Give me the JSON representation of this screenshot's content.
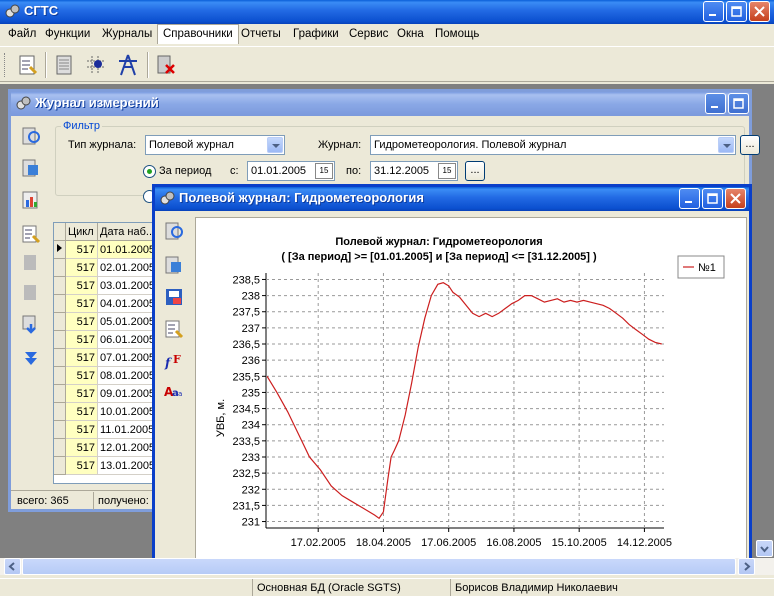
{
  "app": {
    "title": "СГТС"
  },
  "menu": {
    "items": [
      "Файл",
      "Функции",
      "Журналы",
      "Справочники",
      "Отчеты",
      "Графики",
      "Сервис",
      "Окна",
      "Помощь"
    ]
  },
  "journal_window": {
    "title": "Журнал измерений",
    "filter": {
      "group_label": "Фильтр",
      "type_label": "Тип журнала:",
      "type_value": "Полевой журнал",
      "journal_label": "Журнал:",
      "journal_value": "Гидрометеорология. Полевой журнал",
      "period_label": "За период",
      "from_label": "с:",
      "from_value": "01.01.2005",
      "to_label": "по:",
      "to_value": "31.12.2005",
      "dots": "..."
    },
    "grid": {
      "columns": [
        "Цикл",
        "Дата наб..."
      ],
      "rows": [
        {
          "cycle": "517",
          "date": "01.01.2005"
        },
        {
          "cycle": "517",
          "date": "02.01.2005"
        },
        {
          "cycle": "517",
          "date": "03.01.2005"
        },
        {
          "cycle": "517",
          "date": "04.01.2005"
        },
        {
          "cycle": "517",
          "date": "05.01.2005"
        },
        {
          "cycle": "517",
          "date": "06.01.2005"
        },
        {
          "cycle": "517",
          "date": "07.01.2005"
        },
        {
          "cycle": "517",
          "date": "08.01.2005"
        },
        {
          "cycle": "517",
          "date": "09.01.2005"
        },
        {
          "cycle": "517",
          "date": "10.01.2005"
        },
        {
          "cycle": "517",
          "date": "11.01.2005"
        },
        {
          "cycle": "517",
          "date": "12.01.2005"
        },
        {
          "cycle": "517",
          "date": "13.01.2005"
        }
      ]
    },
    "status": {
      "total": "всего: 365",
      "received": "получено:"
    }
  },
  "chart_window": {
    "title": "Полевой журнал: Гидрометеорология"
  },
  "chart_data": {
    "type": "line",
    "title": "Полевой журнал: Гидрометеорология",
    "subtitle": "( [За период] >= [01.01.2005] и [За период] <= [31.12.2005] )",
    "ylabel": "УВБ, м.",
    "xlabel": "",
    "ylim": [
      230.8,
      238.7
    ],
    "yticks": [
      "238,5",
      "238",
      "237,5",
      "237",
      "236,5",
      "236",
      "235,5",
      "235",
      "234,5",
      "234",
      "233,5",
      "233",
      "232,5",
      "232",
      "231,5",
      "231"
    ],
    "xticks": [
      "17.02.2005",
      "18.04.2005",
      "17.06.2005",
      "16.08.2005",
      "15.10.2005",
      "14.12.2005"
    ],
    "xtick_days": [
      48,
      108,
      168,
      228,
      288,
      348
    ],
    "x_days": [
      1,
      10,
      20,
      30,
      40,
      50,
      60,
      70,
      80,
      90,
      100,
      104,
      108,
      112,
      115,
      118,
      122,
      128,
      134,
      140,
      146,
      152,
      158,
      163,
      168,
      172,
      178,
      184,
      190,
      196,
      202,
      208,
      214,
      220,
      226,
      232,
      238,
      244,
      250,
      256,
      262,
      268,
      274,
      280,
      286,
      292,
      298,
      304,
      310,
      316,
      322,
      328,
      334,
      340,
      346,
      352,
      358,
      364
    ],
    "series": [
      {
        "name": "№1",
        "color": "#cc1f1f",
        "values": [
          235.5,
          235.0,
          234.4,
          233.7,
          233.0,
          232.6,
          232.1,
          231.8,
          231.6,
          231.4,
          231.2,
          231.1,
          231.3,
          232.3,
          233.0,
          233.2,
          233.5,
          234.3,
          235.3,
          236.4,
          237.3,
          238.0,
          238.35,
          238.4,
          238.3,
          238.1,
          237.95,
          237.7,
          237.45,
          237.35,
          237.45,
          237.35,
          237.45,
          237.6,
          237.75,
          237.85,
          238.0,
          238.0,
          237.9,
          237.8,
          237.85,
          237.9,
          237.8,
          237.85,
          237.8,
          237.85,
          237.8,
          237.75,
          237.7,
          237.6,
          237.45,
          237.3,
          237.1,
          236.95,
          236.8,
          236.65,
          236.55,
          236.5
        ]
      }
    ],
    "legend": "top-right",
    "grid": true
  },
  "statusbar": {
    "db": "Основная БД (Oracle SGTS)",
    "user": "Борисов Владимир Николаевич"
  }
}
